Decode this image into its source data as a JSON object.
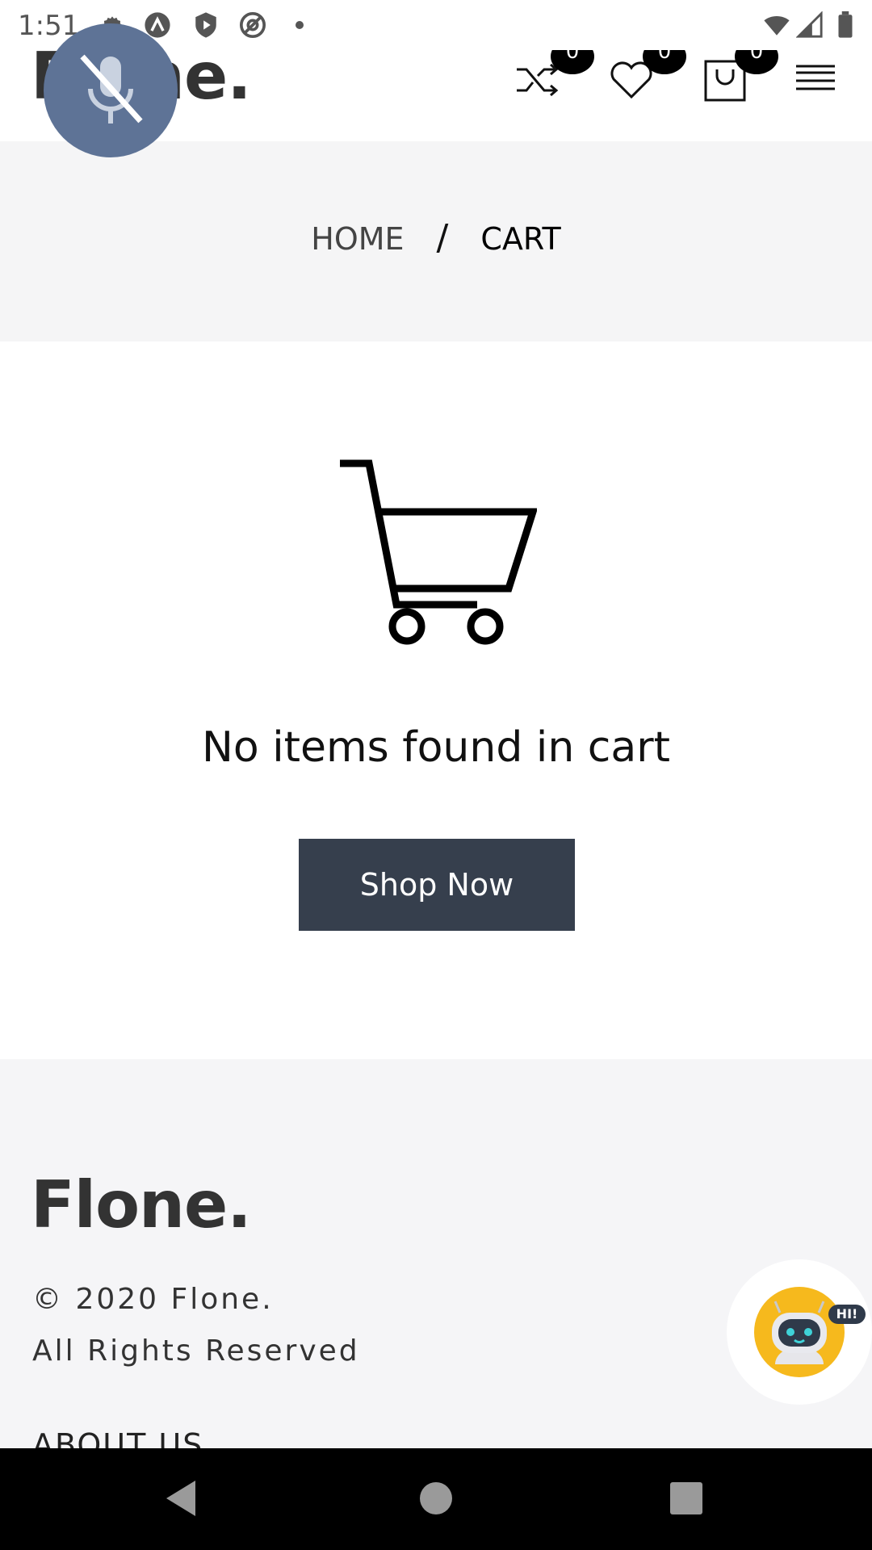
{
  "status_bar": {
    "time": "1:51"
  },
  "header": {
    "logo": "Flone.",
    "compare_count": "0",
    "wishlist_count": "0",
    "cart_count": "0"
  },
  "breadcrumb": {
    "home": "HOME",
    "separator": "/",
    "current": "CART"
  },
  "empty_cart": {
    "message": "No items found in cart",
    "button_label": "Shop Now"
  },
  "footer": {
    "logo": "Flone.",
    "copyright": "© 2020 Flone.",
    "rights": "All Rights Reserved",
    "about_heading": "ABOUT US"
  },
  "chatbot": {
    "badge": "HI!"
  },
  "colors": {
    "button_bg": "#363f4d",
    "mic_fab": "#5e7396",
    "breadcrumb_bg": "#f5f5f6",
    "chatbot_yellow": "#f6b91d"
  }
}
